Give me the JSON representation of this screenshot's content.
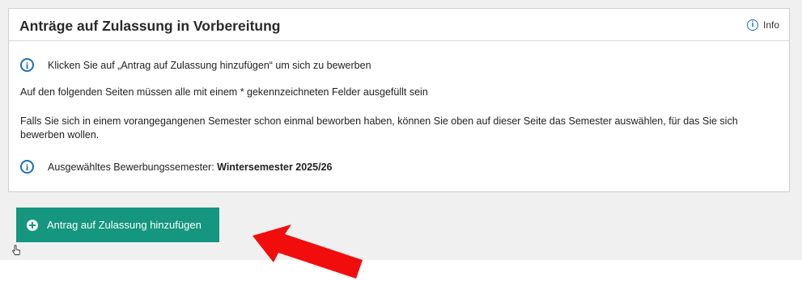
{
  "panel": {
    "title": "Anträge auf Zulassung in Vorbereitung",
    "info_label": "Info",
    "instruction": "Klicken Sie auf „Antrag auf Zulassung hinzufügen“ um sich zu bewerben",
    "required_note": "Auf den folgenden Seiten müssen alle mit einem * gekennzeichneten Felder ausgefüllt sein",
    "previous_semester_note": "Falls Sie sich in einem vorangegangenen Semester schon einmal beworben haben, können Sie oben auf dieser Seite das Semester auswählen, für das Sie sich bewerben wollen.",
    "selected_semester_label": "Ausgewähltes Bewerbungssemester: ",
    "selected_semester_value": "Wintersemester 2025/26"
  },
  "actions": {
    "add_application_label": "Antrag auf Zulassung hinzufügen"
  },
  "colors": {
    "button_bg": "#15967f",
    "info_blue": "#1f6fb8",
    "arrow_red": "#f20d0d",
    "page_bg": "#f0f0f0"
  },
  "icons": {
    "info": "info-circle-icon",
    "plus": "plus-circle-icon",
    "cursor": "hand-pointer-icon",
    "annotation": "red-arrow-icon"
  }
}
